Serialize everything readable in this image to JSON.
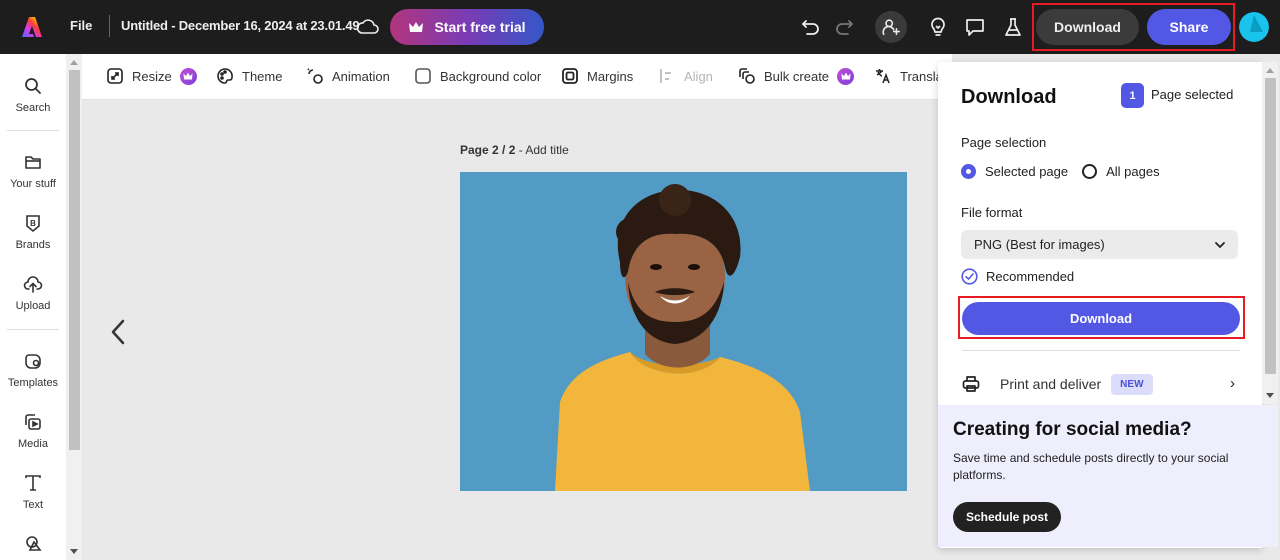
{
  "topbar": {
    "file_label": "File",
    "document_title": "Untitled - December 16, 2024 at 23.01.49",
    "trial_button": "Start free trial",
    "download_button": "Download",
    "share_button": "Share"
  },
  "rail": {
    "items": [
      {
        "label": "Search",
        "icon": "search-icon"
      },
      {
        "label": "Your stuff",
        "icon": "folder-icon"
      },
      {
        "label": "Brands",
        "icon": "brand-icon"
      },
      {
        "label": "Upload",
        "icon": "upload-cloud-icon"
      },
      {
        "label": "Templates",
        "icon": "templates-icon"
      },
      {
        "label": "Media",
        "icon": "media-icon"
      },
      {
        "label": "Text",
        "icon": "text-icon"
      },
      {
        "label": "",
        "icon": "shapes-icon"
      }
    ]
  },
  "toolbar": {
    "items": [
      {
        "label": "Resize",
        "premium": true
      },
      {
        "label": "Theme",
        "premium": false
      },
      {
        "label": "Animation",
        "premium": false
      },
      {
        "label": "Background color",
        "premium": false
      },
      {
        "label": "Margins",
        "premium": false
      },
      {
        "label": "Align",
        "premium": false,
        "disabled": true
      },
      {
        "label": "Bulk create",
        "premium": true
      },
      {
        "label": "Translat",
        "premium": false
      }
    ]
  },
  "canvas": {
    "page_prefix": "Page 2 / 2",
    "page_title_placeholder": " - Add title",
    "image_alt": "Smiling man with curly hair in yellow t-shirt on blue background"
  },
  "download_panel": {
    "title": "Download",
    "selected_count": "1",
    "selected_label": "Page selected",
    "page_selection_label": "Page selection",
    "options": [
      {
        "label": "Selected page",
        "checked": true
      },
      {
        "label": "All pages",
        "checked": false
      }
    ],
    "file_format_label": "File format",
    "file_format_value": "PNG (Best for images)",
    "recommended_label": "Recommended",
    "download_button": "Download",
    "print_label": "Print and deliver",
    "new_badge": "NEW",
    "promo": {
      "title": "Creating for social media?",
      "text": "Save time and schedule posts directly to your social platforms.",
      "button": "Schedule post"
    }
  },
  "colors": {
    "accent": "#5258e4",
    "highlight_box": "#e51c24",
    "artboard_bg": "#529bc5",
    "topbar_bg": "#1d1d1d"
  }
}
